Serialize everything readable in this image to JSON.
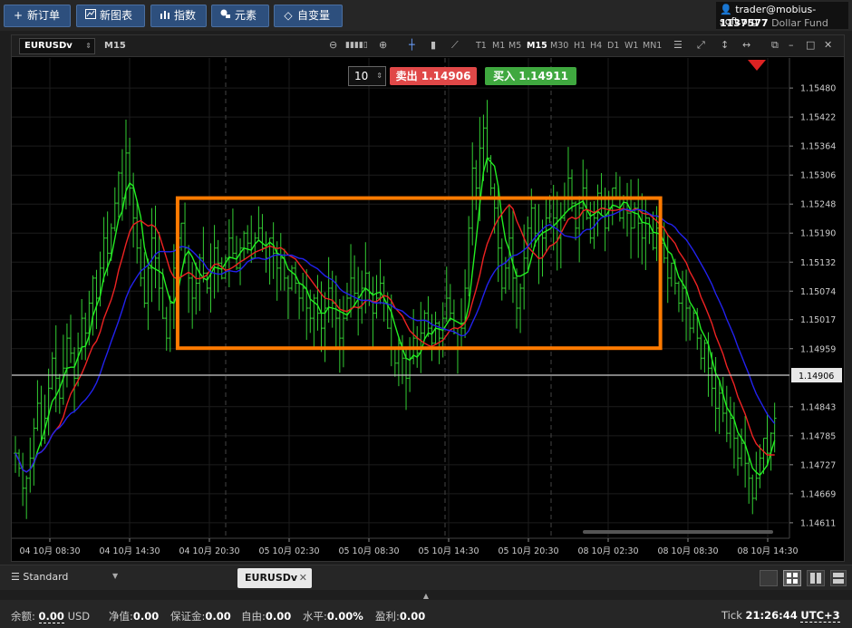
{
  "toolbar": {
    "new_order": "新订单",
    "new_chart": "新图表",
    "indicators": "指数",
    "elements": "元素",
    "variables": "自变量"
  },
  "account": {
    "user": "trader@mobius-soft.org",
    "number": "1137577",
    "fund": "Dollar Fund"
  },
  "chart_toolbar": {
    "symbol": "EURUSDv",
    "timeframe": "M15",
    "timeframes": [
      "T1",
      "M1",
      "M5",
      "M15",
      "M30",
      "H1",
      "H4",
      "D1",
      "W1",
      "MN1"
    ],
    "active_timeframe": "M15"
  },
  "trade": {
    "lot": "10",
    "sell_label": "卖出",
    "sell_price": "1.14906",
    "buy_label": "买入",
    "buy_price": "1.14911"
  },
  "tabs": {
    "template": "Standard",
    "chart_tab": "EURUSDv"
  },
  "status": {
    "balance_label": "余额:",
    "balance": "0.00",
    "currency": "USD",
    "equity_label": "净值:",
    "equity": "0.00",
    "margin_label": "保证金:",
    "margin": "0.00",
    "free_label": "自由:",
    "free": "0.00",
    "level_label": "水平:",
    "level": "0.00%",
    "profit_label": "盈利:",
    "profit": "0.00",
    "tick_label": "Tick",
    "time": "21:26:44",
    "timezone": "UTC+3"
  },
  "colors": {
    "ma_fast": "#22ee22",
    "ma_mid": "#ee2222",
    "ma_slow": "#2222ee",
    "bars": "#33cc33",
    "highlight_box": "#ff7a00",
    "current_price_line": "#cccccc"
  },
  "chart_data": {
    "type": "line",
    "y_ticks": [
      "1.15480",
      "1.15422",
      "1.15364",
      "1.15306",
      "1.15248",
      "1.15190",
      "1.15132",
      "1.15074",
      "1.15017",
      "1.14959",
      "1.14843",
      "1.14785",
      "1.14727",
      "1.14669",
      "1.14611"
    ],
    "current_price": "1.14906",
    "ylim": [
      1.1458,
      1.1554
    ],
    "x_ticks": [
      "04 10月 08:30",
      "04 10月 14:30",
      "04 10月 20:30",
      "05 10月 02:30",
      "05 10月 08:30",
      "05 10月 14:30",
      "05 10月 20:30",
      "08 10月 02:30",
      "08 10月 08:30",
      "08 10月 14:30"
    ],
    "highlight_range": {
      "x_from_bar": 44,
      "x_to_bar": 175,
      "y_from": 1.1496,
      "y_to": 1.1526
    },
    "closes": [
      1.1475,
      1.1472,
      1.1468,
      1.147,
      1.1474,
      1.148,
      1.1485,
      1.1478,
      1.1482,
      1.1488,
      1.1494,
      1.149,
      1.1486,
      1.1492,
      1.1498,
      1.1495,
      1.149,
      1.1496,
      1.1502,
      1.1499,
      1.1505,
      1.151,
      1.1506,
      1.1512,
      1.1518,
      1.1515,
      1.152,
      1.1525,
      1.1531,
      1.1526,
      1.1535,
      1.1528,
      1.1522,
      1.1516,
      1.151,
      1.1505,
      1.1512,
      1.1518,
      1.1514,
      1.1508,
      1.1502,
      1.1498,
      1.1505,
      1.1512,
      1.1518,
      1.1521,
      1.1516,
      1.151,
      1.1506,
      1.1509,
      1.1514,
      1.1511,
      1.1508,
      1.1512,
      1.1516,
      1.1513,
      1.151,
      1.1514,
      1.1518,
      1.1515,
      1.1512,
      1.1516,
      1.1519,
      1.1517,
      1.1514,
      1.1518,
      1.152,
      1.1516,
      1.1514,
      1.1518,
      1.1515,
      1.1512,
      1.1514,
      1.151,
      1.1508,
      1.1512,
      1.1509,
      1.1506,
      1.1508,
      1.1504,
      1.1502,
      1.1506,
      1.1503,
      1.15,
      1.1504,
      1.1508,
      1.1505,
      1.1502,
      1.1498,
      1.1502,
      1.1506,
      1.151,
      1.1507,
      1.1504,
      1.1508,
      1.1511,
      1.1507,
      1.1503,
      1.1506,
      1.1509,
      1.1505,
      1.15,
      1.1496,
      1.1493,
      1.1497,
      1.1494,
      1.149,
      1.1494,
      1.1498,
      1.1495,
      1.1499,
      1.1503,
      1.15,
      1.1497,
      1.1501,
      1.1498,
      1.1502,
      1.1506,
      1.1503,
      1.1499,
      1.1496,
      1.15,
      1.1508,
      1.152,
      1.1532,
      1.1528,
      1.1536,
      1.154,
      1.1534,
      1.1528,
      1.1524,
      1.1516,
      1.1508,
      1.1512,
      1.1518,
      1.151,
      1.1504,
      1.1508,
      1.1514,
      1.152,
      1.1524,
      1.1519,
      1.1514,
      1.1518,
      1.1522,
      1.1526,
      1.1522,
      1.1518,
      1.1522,
      1.1526,
      1.153,
      1.1525,
      1.152,
      1.1524,
      1.1528,
      1.1522,
      1.1518,
      1.1522,
      1.1527,
      1.1524,
      1.152,
      1.1524,
      1.1528,
      1.1526,
      1.1522,
      1.1526,
      1.1523,
      1.152,
      1.1524,
      1.1521,
      1.1518,
      1.1522,
      1.1519,
      1.1516,
      1.152,
      1.1517,
      1.1514,
      1.151,
      1.1513,
      1.1509,
      1.1505,
      1.1508,
      1.1504,
      1.15,
      1.1503,
      1.1498,
      1.1494,
      1.1497,
      1.1492,
      1.1488,
      1.1484,
      1.1487,
      1.1483,
      1.1479,
      1.1482,
      1.1478,
      1.1474,
      1.1477,
      1.1473,
      1.147,
      1.1466,
      1.147,
      1.1474,
      1.1478,
      1.1475,
      1.1479,
      1.1482
    ]
  }
}
